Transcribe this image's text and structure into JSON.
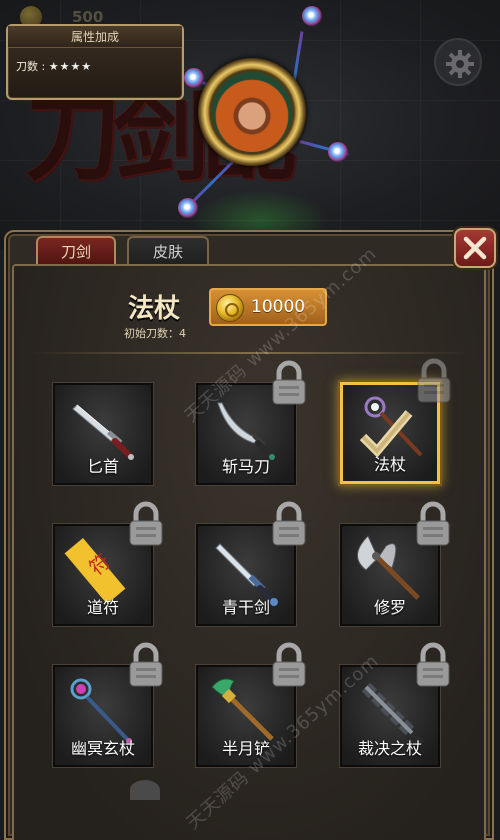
{
  "hud": {
    "coins": "500"
  },
  "attribute_panel": {
    "title": "属性加成",
    "label": "刀数",
    "separator": ":",
    "stars": "★★★★",
    "star_count": 4
  },
  "tabs": [
    {
      "label": "刀剑",
      "active": true
    },
    {
      "label": "皮肤",
      "active": false
    }
  ],
  "selected_weapon": {
    "name": "法杖",
    "subtitle": "初始刀数：4",
    "price": "10000"
  },
  "weapons": [
    {
      "label": "匕首",
      "locked": false,
      "selected": false,
      "icon": "dagger-icon"
    },
    {
      "label": "斩马刀",
      "locked": true,
      "selected": false,
      "icon": "scimitar-icon"
    },
    {
      "label": "法杖",
      "locked": true,
      "selected": true,
      "icon": "staff-icon"
    },
    {
      "label": "道符",
      "locked": true,
      "selected": false,
      "icon": "talisman-icon"
    },
    {
      "label": "青干剑",
      "locked": true,
      "selected": false,
      "icon": "sword-icon"
    },
    {
      "label": "修罗",
      "locked": true,
      "selected": false,
      "icon": "axe-icon"
    },
    {
      "label": "幽冥玄杖",
      "locked": true,
      "selected": false,
      "icon": "gem-staff-icon"
    },
    {
      "label": "半月铲",
      "locked": true,
      "selected": false,
      "icon": "crescent-spade-icon"
    },
    {
      "label": "裁决之杖",
      "locked": true,
      "selected": false,
      "icon": "judgment-staff-icon"
    }
  ],
  "watermarks": [
    "天天源码 www.365ym.com",
    "天天源码 www.365ym.com"
  ],
  "colors": {
    "panel_border": "#8c7350",
    "selected_glow": "#f0c24a",
    "active_tab": "#7a2620",
    "close_button": "#a33a35",
    "price_box": "#d79135"
  }
}
